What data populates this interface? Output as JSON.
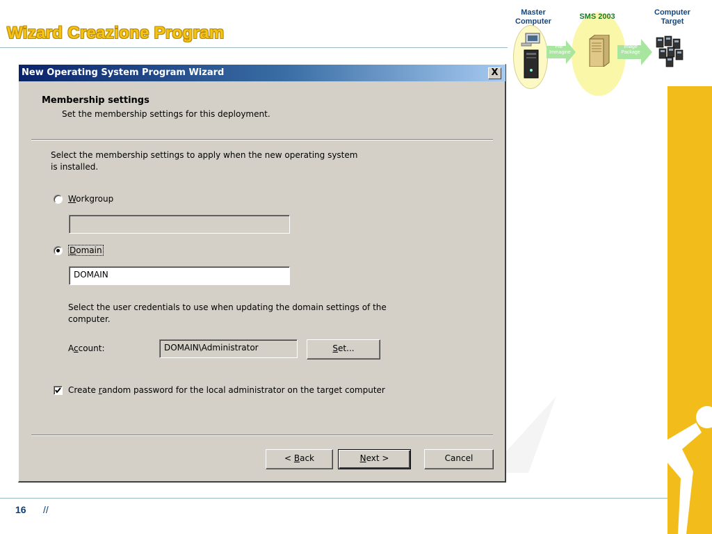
{
  "slide": {
    "title": "Wizard Creazione Program",
    "page_number": "16",
    "footer_text": "//"
  },
  "diagram": {
    "master_label": "Master Computer",
    "server_label": "SMS 2003",
    "target_label": "Computer Target",
    "arrow1_text": "File Immagine",
    "arrow2_text": "Image Package",
    "colors": {
      "oval": "#fbf7a8",
      "arrow": "#a8e6a0",
      "label": "#16467a"
    }
  },
  "dialog": {
    "title": "New Operating System Program Wizard",
    "close_glyph": "X",
    "header_title": "Membership settings",
    "header_subtitle": "Set the membership settings for this deployment.",
    "intro_line1": "Select the membership settings to apply when the new operating system",
    "intro_line2": "is installed.",
    "workgroup": {
      "label_first": "W",
      "label_rest": "orkgroup",
      "selected": false,
      "value": ""
    },
    "domain": {
      "label_first": "D",
      "label_rest": "omain",
      "selected": true,
      "value": "DOMAIN"
    },
    "cred_line1": "Select the user credentials to use when updating the domain settings of the",
    "cred_line2": "computer.",
    "account": {
      "label_before": "A",
      "label_underlined": "c",
      "label_after": "count:",
      "value": "DOMAIN\\Administrator"
    },
    "set_button": {
      "underlined": "S",
      "rest": "et..."
    },
    "random_password": {
      "checked": true,
      "label_before": "Create ",
      "label_underlined": "r",
      "label_after": "andom password for the local administrator on the target computer"
    },
    "back_button": {
      "before": "< ",
      "underlined": "B",
      "rest": "ack"
    },
    "next_button": {
      "underlined": "N",
      "rest": "ext >"
    },
    "cancel_button": "Cancel"
  },
  "colors": {
    "title_yellow": "#f5c21a",
    "band_yellow": "#f2bd1a",
    "footer_blue": "#0c3d78",
    "dialog_face": "#d4d0c8",
    "titlebar_start": "#0a246a",
    "titlebar_end": "#a6caf0"
  }
}
